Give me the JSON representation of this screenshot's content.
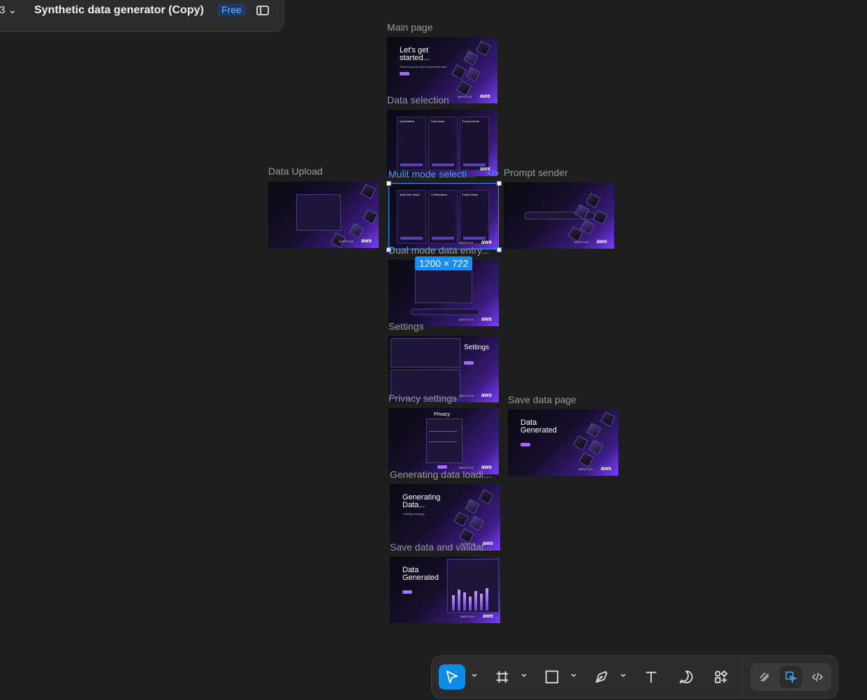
{
  "header": {
    "menu_icon": "menu-chevron-icon",
    "menu_glyph": "3 ⌄",
    "title": "Synthetic data generator (Copy)",
    "plan_badge": "Free",
    "panel_toggle_icon": "sidebar-toggle-icon"
  },
  "frames": {
    "main": {
      "label": "Main page",
      "heading": "Let's get started...",
      "sub": "Select how you want to generate data",
      "logo1": "IMPETUS",
      "logo2": "aws"
    },
    "data_selection": {
      "label": "Data selection",
      "cols": [
        "Quantitative",
        "Dual Mode",
        "Prompt Mode"
      ],
      "logo2": "aws"
    },
    "data_upload": {
      "label": "Data Upload",
      "logo1": "IMPETUS",
      "logo2": "aws"
    },
    "multi_mode": {
      "label": "Mulit mode selecti...",
      "cols": [
        "Multi-Gen Mode",
        "Certifications",
        "Fabric Mode"
      ],
      "logo1": "IMPETUS",
      "logo2": "aws"
    },
    "prompt_sender": {
      "label": "Prompt sender",
      "logo1": "IMPETUS",
      "logo2": "aws"
    },
    "dual_entry": {
      "label": "Dual mode data entry...",
      "logo1": "IMPETUS",
      "logo2": "aws"
    },
    "settings": {
      "label": "Settings",
      "heading": "Settings",
      "logo1": "IMPETUS",
      "logo2": "aws"
    },
    "privacy": {
      "label": "Privacy settings",
      "heading": "Privacy",
      "logo1": "IMPETUS",
      "logo2": "aws"
    },
    "save_page": {
      "label": "Save data page",
      "heading": "Data Generated",
      "logo1": "IMPETUS",
      "logo2": "aws"
    },
    "loading": {
      "label": "Generating data loadi...",
      "heading": "Generating Data...",
      "sub": "Loading message...",
      "logo1": "IMPETUS",
      "logo2": "aws"
    },
    "save_validate": {
      "label": "Save data and validat...",
      "heading": "Data Generated",
      "logo1": "IMPETUS",
      "logo2": "aws"
    }
  },
  "selection": {
    "dimensions": "1200 × 722",
    "code_icon": "</>"
  },
  "toolbar": {
    "tools": [
      "move-tool",
      "frame-tool",
      "rectangle-tool",
      "pen-tool",
      "text-tool",
      "comment-tool",
      "actions-tool"
    ],
    "modes": [
      "draw-mode",
      "design-mode",
      "dev-mode"
    ],
    "accent": "#0d8ce9"
  }
}
